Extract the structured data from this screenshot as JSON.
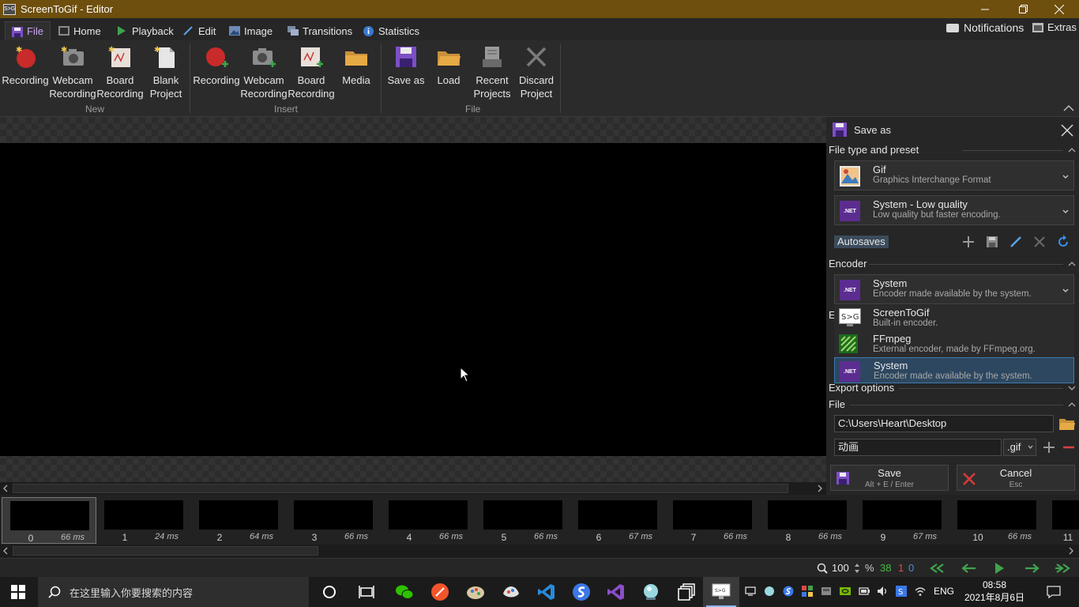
{
  "window": {
    "title": "ScreenToGif - Editor",
    "icon_text": "S>G"
  },
  "tabs": [
    {
      "label": "File",
      "icon": "floppy-icon"
    },
    {
      "label": "Home",
      "icon": "home-icon"
    },
    {
      "label": "Playback",
      "icon": "play-icon"
    },
    {
      "label": "Edit",
      "icon": "pencil-icon"
    },
    {
      "label": "Image",
      "icon": "image-icon"
    },
    {
      "label": "Transitions",
      "icon": "transitions-icon"
    },
    {
      "label": "Statistics",
      "icon": "info-icon"
    }
  ],
  "right_tabs": {
    "notifications": "Notifications",
    "extras": "Extras"
  },
  "ribbon": {
    "new": {
      "label": "New",
      "recording": "Recording",
      "webcam_1": "Webcam",
      "webcam_2": "Recording",
      "board_1": "Board",
      "board_2": "Recording",
      "blank_1": "Blank",
      "blank_2": "Project"
    },
    "insert": {
      "label": "Insert",
      "recording": "Recording",
      "webcam_1": "Webcam",
      "webcam_2": "Recording",
      "board_1": "Board",
      "board_2": "Recording",
      "media": "Media"
    },
    "file": {
      "label": "File",
      "save_as": "Save as",
      "load": "Load",
      "recent_1": "Recent",
      "recent_2": "Projects",
      "discard_1": "Discard",
      "discard_2": "Project"
    }
  },
  "panel": {
    "title": "Save as",
    "section_file_type": "File type and preset",
    "file_type": {
      "name": "Gif",
      "desc": "Graphics Interchange Format"
    },
    "preset": {
      "name": "System - Low quality",
      "desc": "Low quality but faster encoding."
    },
    "autosaves": "Autosaves",
    "section_encoder": "Encoder",
    "encoder_selected": {
      "name": "System",
      "desc": "Encoder made available by the system.",
      "badge": ".NET"
    },
    "encoder_hidden_letter": "E",
    "encoder_options": [
      {
        "name": "ScreenToGif",
        "desc": "Built-in encoder.",
        "badge": "S>G"
      },
      {
        "name": "FFmpeg",
        "desc": "External encoder, made by FFmpeg.org."
      },
      {
        "name": "System",
        "desc": "Encoder made available by the system.",
        "badge": ".NET"
      }
    ],
    "section_export": "Export options",
    "section_file": "File",
    "output_folder": "C:\\Users\\Heart\\Desktop",
    "file_name": "动画",
    "extension": ".gif",
    "save_label": "Save",
    "save_shortcut": "Alt + E / Enter",
    "cancel_label": "Cancel",
    "cancel_shortcut": "Esc"
  },
  "frames": [
    {
      "num": "0",
      "ms": "66 ms"
    },
    {
      "num": "1",
      "ms": "24 ms"
    },
    {
      "num": "2",
      "ms": "64 ms"
    },
    {
      "num": "3",
      "ms": "66 ms"
    },
    {
      "num": "4",
      "ms": "66 ms"
    },
    {
      "num": "5",
      "ms": "66 ms"
    },
    {
      "num": "6",
      "ms": "67 ms"
    },
    {
      "num": "7",
      "ms": "66 ms"
    },
    {
      "num": "8",
      "ms": "66 ms"
    },
    {
      "num": "9",
      "ms": "67 ms"
    },
    {
      "num": "10",
      "ms": "66 ms"
    },
    {
      "num": "11",
      "ms": ""
    }
  ],
  "status": {
    "zoom": "100",
    "zoom_unit": "%",
    "frame_total": "38",
    "frame_selected": "1",
    "frame_index": "0"
  },
  "taskbar": {
    "search_placeholder": "在这里输入你要搜索的内容",
    "lang": "ENG",
    "time": "08:58",
    "date": "2021年8月6日"
  },
  "colors": {
    "titlebar": "#6e4f0d",
    "accent": "#c9a5f0",
    "frame_total": "#3fbf3f",
    "frame_selected": "#e04848",
    "frame_index": "#4a90e2"
  }
}
